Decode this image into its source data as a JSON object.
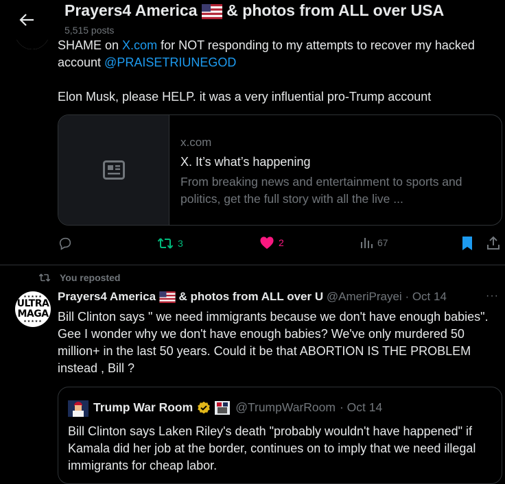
{
  "header": {
    "title": "Prayers4 America",
    "title_rest": "& photos from ALL over USA",
    "posts_count": "5,515 posts"
  },
  "tweet1": {
    "line1_pre": "SHAME on ",
    "line1_link": "X.com",
    "line1_post": " for NOT responding to my attempts to recover my hacked",
    "line2_pre": "account ",
    "line2_mention": "@PRAISETRIUNEGOD",
    "paragraph2": "Elon Musk, please HELP. it was a very influential pro-Trump account",
    "card": {
      "domain": "x.com",
      "title": "X. It’s what’s happening",
      "description": "From breaking news and entertainment to sports and politics, get the full story with all the live ..."
    },
    "actions": {
      "reposts": "3",
      "likes": "2",
      "views": "67"
    }
  },
  "tweet2": {
    "repost_label": "You reposted",
    "avatar_text_1": "ULTRA",
    "avatar_text_2": "MAGA",
    "author_name": "Prayers4 America",
    "author_name_rest": "& photos from ALL over U",
    "author_handle": "@AmeriPrayei",
    "date": "· Oct 14",
    "more": "···",
    "text": "Bill Clinton says \" we need immigrants because we don't have enough babies\". Gee I wonder why we don't have enough babies?  We've only murdered 50 million+  in the last 50 years. Could it be that ABORTION IS THE PROBLEM instead , Bill ?",
    "quote": {
      "author_name": "Trump War Room",
      "author_handle": "@TrumpWarRoom",
      "date": "· Oct 14",
      "text": "Bill Clinton says Laken Riley's death \"probably wouldn't have happened\" if Kamala did her job at the border, continues on to imply that we need illegal immigrants for cheap labor."
    }
  },
  "colors": {
    "accent": "#1d9bf0",
    "repost_green": "#00ba7c",
    "like_pink": "#f91880",
    "muted": "#71767b"
  }
}
